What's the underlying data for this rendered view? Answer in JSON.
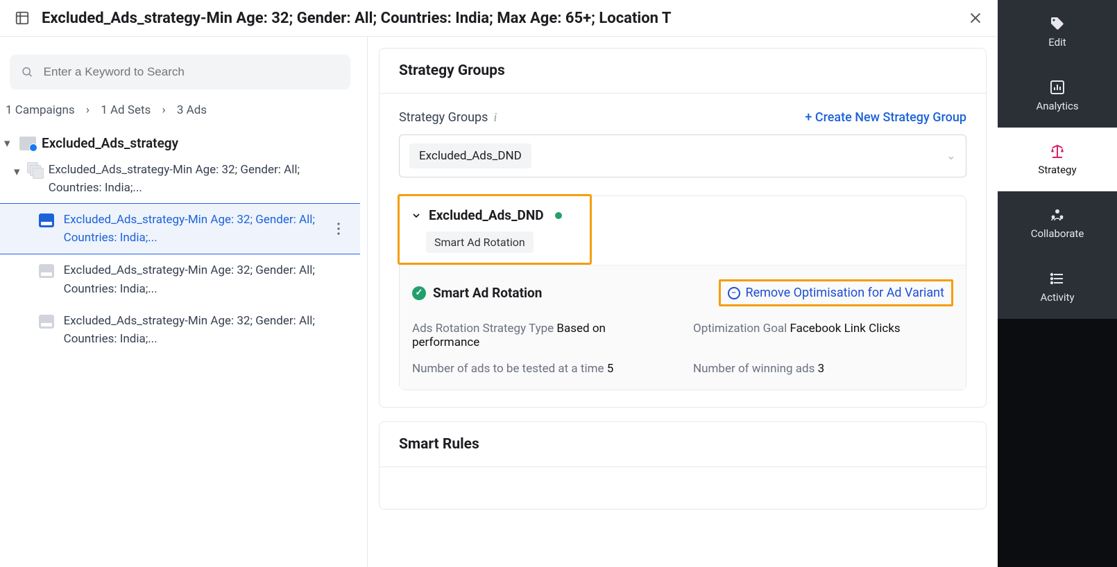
{
  "header": {
    "title": "Excluded_Ads_strategy-Min Age: 32; Gender: All; Countries: India; Max Age: 65+; Location T"
  },
  "search": {
    "placeholder": "Enter a Keyword to Search"
  },
  "breadcrumb": {
    "a": "1 Campaigns",
    "b": "1 Ad Sets",
    "c": "3 Ads"
  },
  "tree": {
    "campaign": "Excluded_Ads_strategy",
    "adset": "Excluded_Ads_strategy-Min Age: 32; Gender: All; Countries: India;...",
    "ads": [
      "Excluded_Ads_strategy-Min Age: 32; Gender: All; Countries: India;...",
      "Excluded_Ads_strategy-Min Age: 32; Gender: All; Countries: India;...",
      "Excluded_Ads_strategy-Min Age: 32; Gender: All; Countries: India;..."
    ]
  },
  "panel": {
    "strategy_groups_title": "Strategy Groups",
    "strategy_groups_label": "Strategy Groups",
    "create_link": "+ Create New Strategy Group",
    "selected_group": "Excluded_Ads_DND",
    "group_name": "Excluded_Ads_DND",
    "group_tag": "Smart Ad Rotation",
    "rotation_title": "Smart Ad Rotation",
    "remove_link": "Remove Optimisation for Ad Variant",
    "kv": {
      "rotation_type_label": "Ads Rotation Strategy Type",
      "rotation_type_value": "Based on performance",
      "opt_goal_label": "Optimization Goal",
      "opt_goal_value": "Facebook Link Clicks",
      "test_count_label": "Number of ads to be tested at a time",
      "test_count_value": "5",
      "win_count_label": "Number of winning ads",
      "win_count_value": "3"
    },
    "smart_rules_title": "Smart Rules"
  },
  "rail": {
    "edit": "Edit",
    "analytics": "Analytics",
    "strategy": "Strategy",
    "collaborate": "Collaborate",
    "activity": "Activity"
  }
}
